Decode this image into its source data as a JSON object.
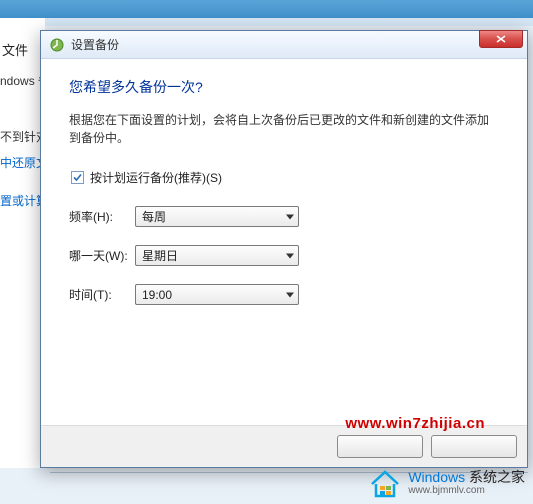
{
  "background": {
    "label_files": "文件",
    "label_windows": "ndows 备",
    "label_notarget": "不到针对",
    "link_restore": "中还原文件",
    "link_computer": "置或计算机"
  },
  "dialog": {
    "title": "设置备份",
    "close_alt": "close",
    "heading": "您希望多久备份一次?",
    "desc": "根据您在下面设置的计划，会将自上次备份后已更改的文件和新创建的文件添加到备份中。",
    "checkbox_label": "按计划运行备份(推荐)(S)",
    "checkbox_checked": true,
    "rows": [
      {
        "label": "频率(H):",
        "value": "每周"
      },
      {
        "label": "哪一天(W):",
        "value": "星期日"
      },
      {
        "label": "时间(T):",
        "value": "19:00"
      }
    ]
  },
  "watermark": {
    "url": "www.win7zhijia.cn",
    "brand_main_1": "Windows",
    "brand_main_2": " 系统之家",
    "brand_sub": "www.bjmmlv.com"
  }
}
